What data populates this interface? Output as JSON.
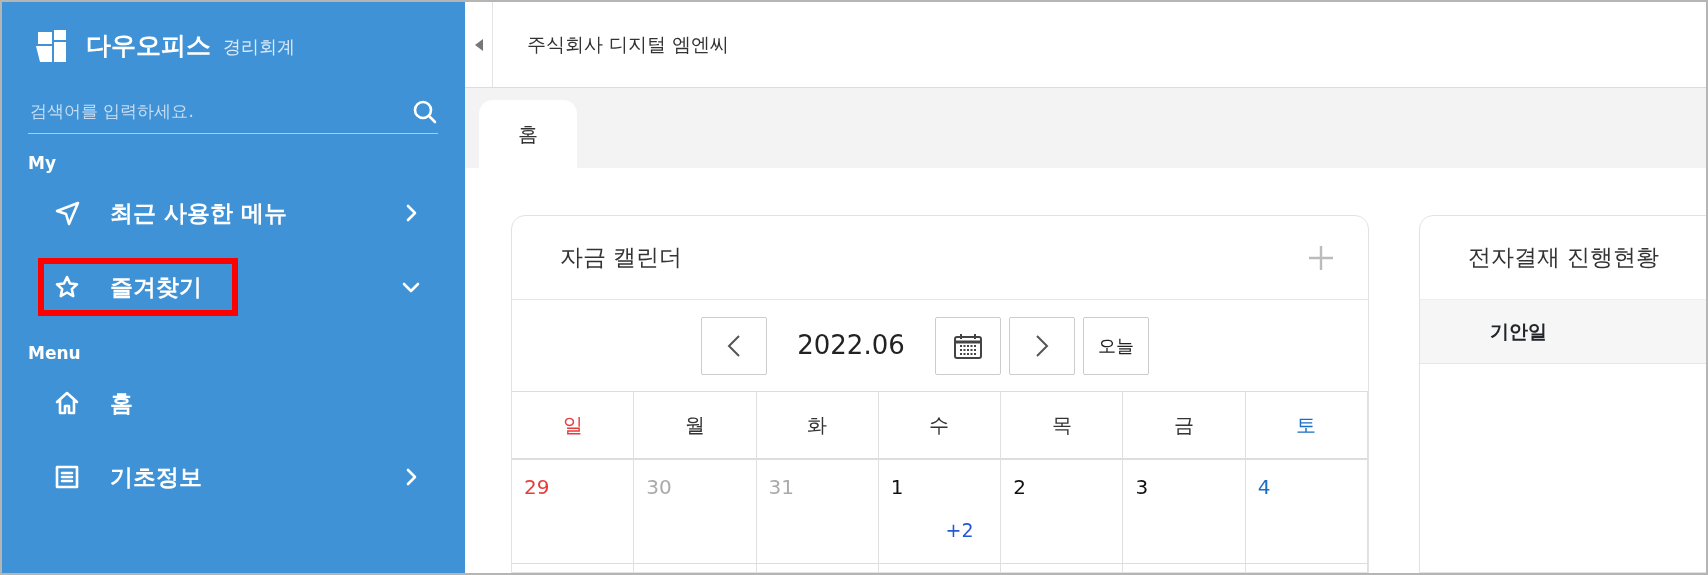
{
  "sidebar": {
    "brand": "다우오피스",
    "product": "경리회계",
    "search": {
      "placeholder": "검색어를 입력하세요."
    },
    "sections": [
      {
        "title": "My",
        "items": [
          {
            "label": "최근 사용한 메뉴",
            "kind": "send",
            "has_children": true,
            "expanded": false,
            "highlighted": false
          },
          {
            "label": "즐겨찾기",
            "kind": "star",
            "has_children": true,
            "expanded": true,
            "highlighted": true
          }
        ]
      },
      {
        "title": "Menu",
        "items": [
          {
            "label": "홈",
            "kind": "home",
            "has_children": false,
            "highlighted": false
          },
          {
            "label": "기초정보",
            "kind": "list",
            "has_children": true,
            "expanded": false,
            "highlighted": false
          }
        ]
      }
    ]
  },
  "topbar": {
    "company": "주식회사 디지털 엠엔씨"
  },
  "tabs": [
    {
      "label": "홈",
      "selected": true
    }
  ],
  "calendar": {
    "title": "자금 캘린더",
    "month": "2022.06",
    "today_button": "오늘",
    "weekdays": [
      {
        "label": "일",
        "color": "#e83c3c"
      },
      {
        "label": "월",
        "color": "#333333"
      },
      {
        "label": "화",
        "color": "#333333"
      },
      {
        "label": "수",
        "color": "#333333"
      },
      {
        "label": "목",
        "color": "#333333"
      },
      {
        "label": "금",
        "color": "#333333"
      },
      {
        "label": "토",
        "color": "#1a6fc4"
      }
    ],
    "days": [
      {
        "date": "29",
        "color": "#e83c3c"
      },
      {
        "date": "30",
        "color": "#aaaaaa"
      },
      {
        "date": "31",
        "color": "#aaaaaa"
      },
      {
        "date": "1",
        "color": "#111111",
        "more": "+2"
      },
      {
        "date": "2",
        "color": "#111111"
      },
      {
        "date": "3",
        "color": "#111111"
      },
      {
        "date": "4",
        "color": "#1a6fc4"
      }
    ]
  },
  "approval": {
    "title": "전자결재 진행현황",
    "columns": [
      "기안일"
    ]
  }
}
